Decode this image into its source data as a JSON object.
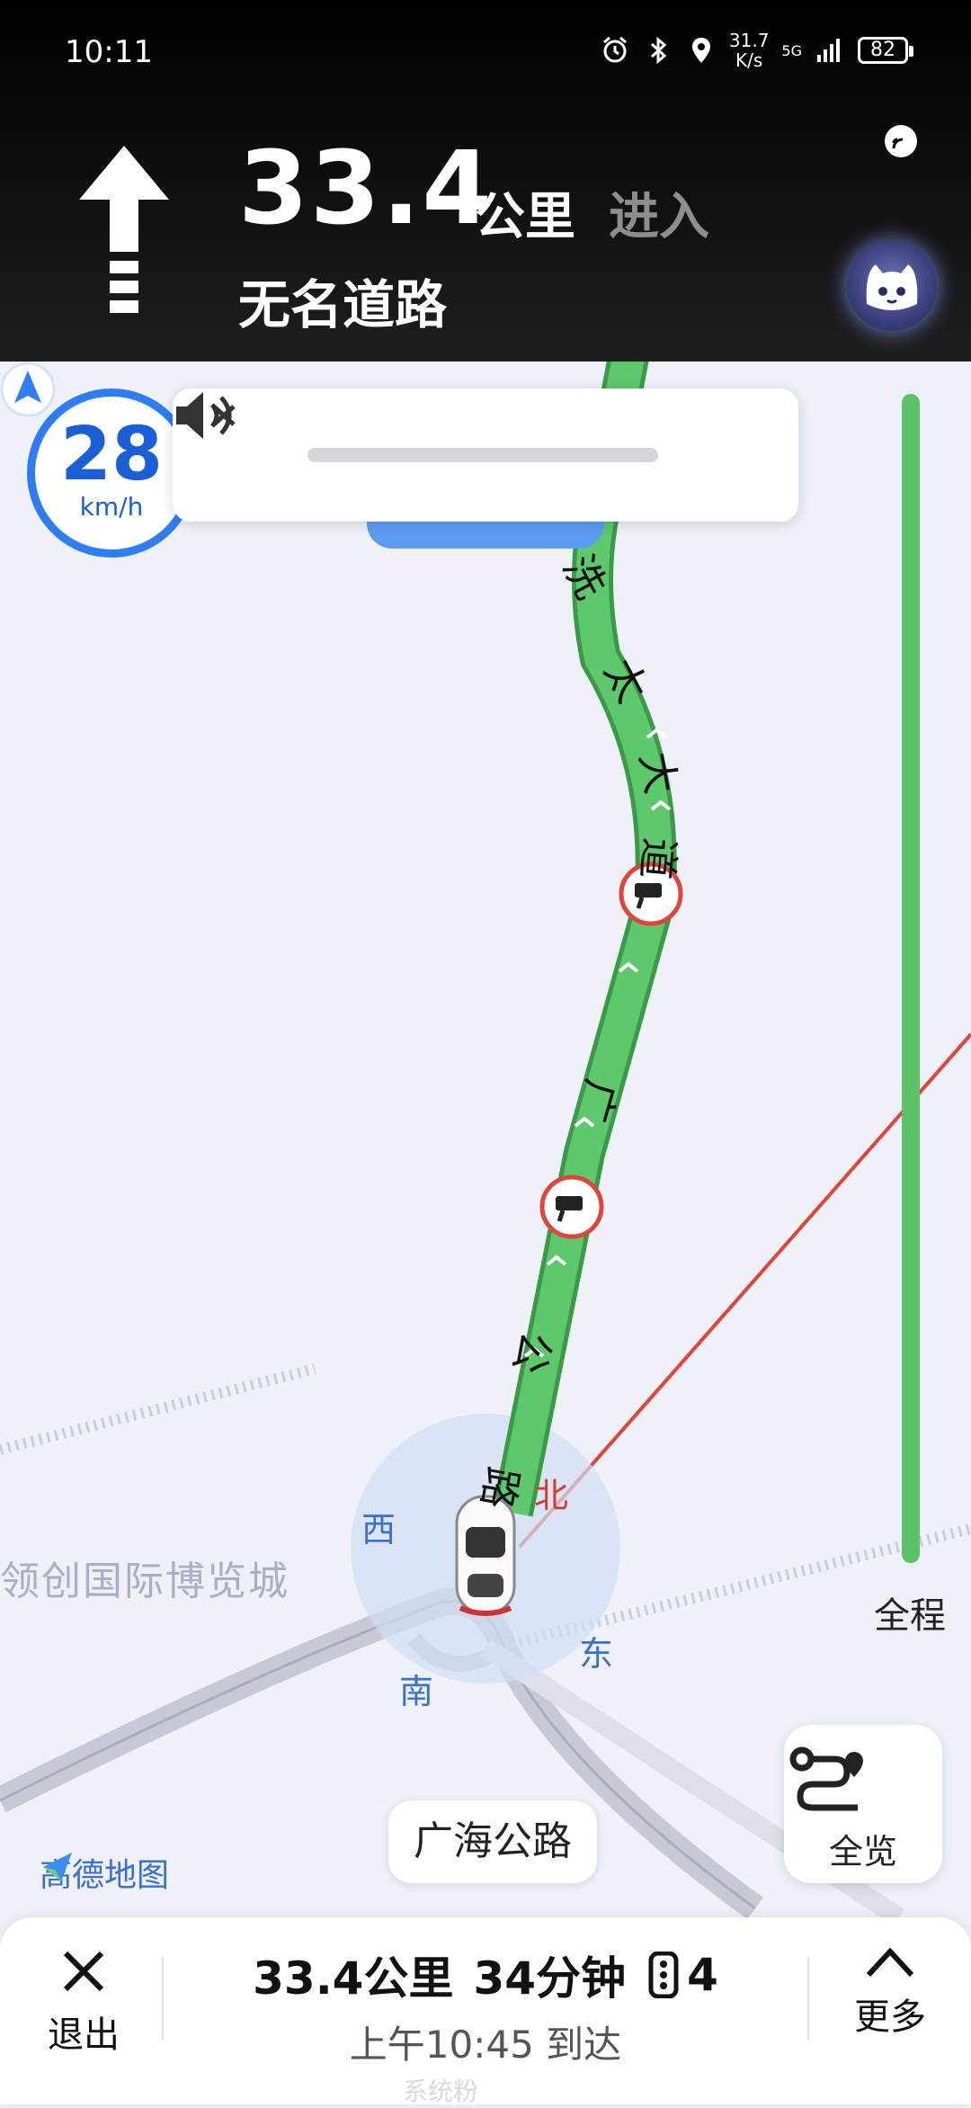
{
  "status_bar": {
    "time": "10:11",
    "net_speed_value": "31.7",
    "net_speed_unit": "K/s",
    "network": "5G",
    "battery": "82"
  },
  "guidance": {
    "distance": "33.4",
    "distance_unit": "公里",
    "action": "进入",
    "road_name": "无名道路",
    "turn_icon": "straight-arrow-icon"
  },
  "speed": {
    "value": "28",
    "unit": "km/h"
  },
  "map": {
    "route_road_chars": [
      "洗",
      "太",
      "大",
      "道",
      "广",
      "公",
      "路"
    ],
    "compass": {
      "north": "北",
      "south": "南",
      "east": "东",
      "west": "西"
    },
    "poi_label": "领创国际博览城",
    "current_road": "广海公路",
    "brand": "高德地图",
    "overview_label": "全览",
    "full_route_label": "全程",
    "route_color": "#4cba5c",
    "camera_icon": "speed-camera-icon"
  },
  "bottom_bar": {
    "exit_label": "退出",
    "distance": "33.4公里",
    "duration": "34分钟",
    "traffic_lights": "4",
    "eta": "上午10:45 到达",
    "more_label": "更多"
  },
  "watermark": "系统粉"
}
